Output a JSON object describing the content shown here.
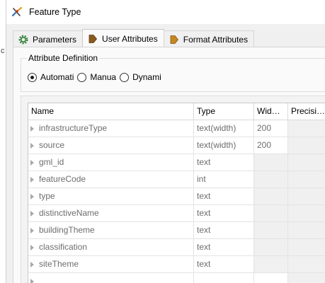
{
  "window": {
    "title": "Feature Type"
  },
  "leftstrip": {
    "fragment": "c"
  },
  "tabs": [
    {
      "label": "Parameters",
      "icon": "gear-icon"
    },
    {
      "label": "User Attributes",
      "icon": "attribute-arrow-icon"
    },
    {
      "label": "Format Attributes",
      "icon": "attribute-arrow-icon"
    }
  ],
  "attribute_definition": {
    "legend": "Attribute Definition",
    "options": [
      {
        "label": "Automati",
        "checked": true
      },
      {
        "label": "Manua",
        "checked": false
      },
      {
        "label": "Dynami",
        "checked": false
      }
    ]
  },
  "table": {
    "columns": [
      "Name",
      "Type",
      "Wid…",
      "Precisi…"
    ],
    "rows": [
      {
        "name": "infrastructureType",
        "type": "text(width)",
        "width": "200"
      },
      {
        "name": "source",
        "type": "text(width)",
        "width": "200"
      },
      {
        "name": "gml_id",
        "type": "text",
        "width": ""
      },
      {
        "name": "featureCode",
        "type": "int",
        "width": ""
      },
      {
        "name": "type",
        "type": "text",
        "width": ""
      },
      {
        "name": "distinctiveName",
        "type": "text",
        "width": ""
      },
      {
        "name": "buildingTheme",
        "type": "text",
        "width": ""
      },
      {
        "name": "classification",
        "type": "text",
        "width": ""
      },
      {
        "name": "siteTheme",
        "type": "text",
        "width": ""
      },
      {
        "name": "",
        "type": "",
        "width": ""
      }
    ]
  }
}
